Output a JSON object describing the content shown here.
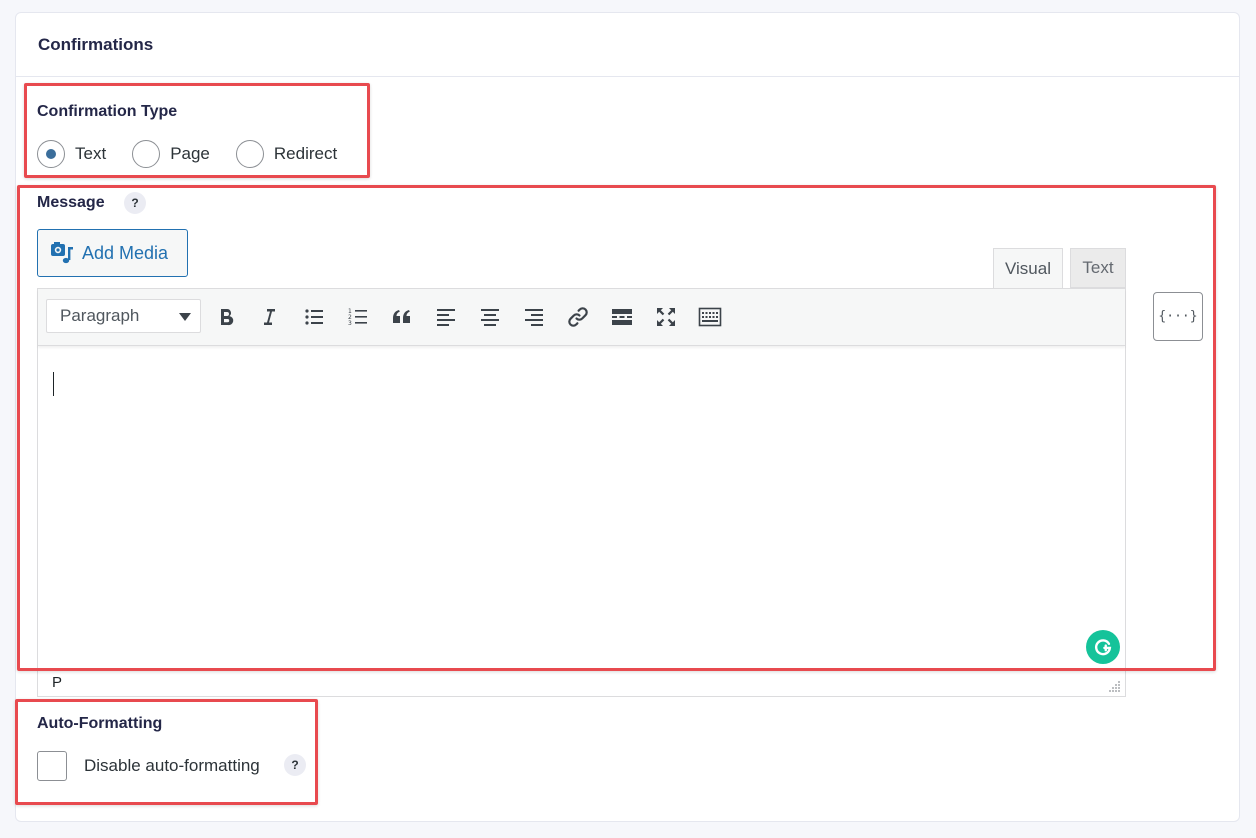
{
  "panel": {
    "title": "Confirmations"
  },
  "confirmation_type": {
    "label": "Confirmation Type",
    "options": [
      {
        "label": "Text",
        "selected": true
      },
      {
        "label": "Page",
        "selected": false
      },
      {
        "label": "Redirect",
        "selected": false
      }
    ]
  },
  "message": {
    "label": "Message",
    "help": "?",
    "add_media_label": "Add Media",
    "tabs": {
      "visual": "Visual",
      "text": "Text",
      "active": "Visual"
    },
    "format_select": "Paragraph",
    "toolbar_icons": [
      "bold-icon",
      "italic-icon",
      "bulleted-list-icon",
      "numbered-list-icon",
      "blockquote-icon",
      "align-left-icon",
      "align-center-icon",
      "align-right-icon",
      "link-icon",
      "read-more-icon",
      "fullscreen-icon",
      "toolbar-toggle-icon"
    ],
    "content": "",
    "path": "P",
    "smart_tags_icon": "{···}"
  },
  "auto_formatting": {
    "label": "Auto-Formatting",
    "checkbox_label": "Disable auto-formatting",
    "checked": false,
    "help": "?"
  },
  "colors": {
    "highlight": "#e84a4f",
    "primary": "#2271b1",
    "radio_selected": "#3b6e9b",
    "grammarly": "#15c39a"
  }
}
